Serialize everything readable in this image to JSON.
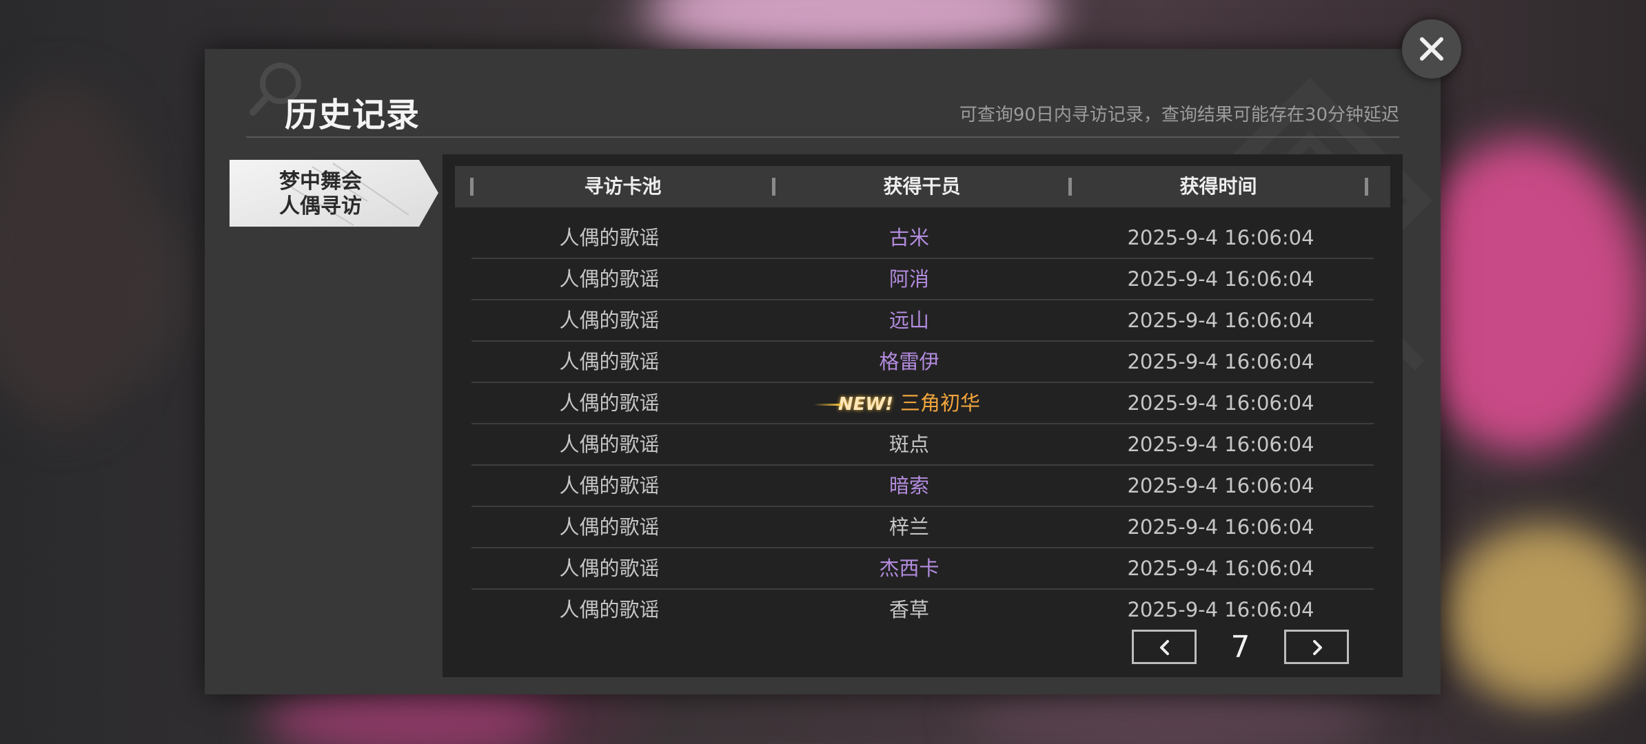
{
  "dialog": {
    "title": "历史记录",
    "notice": "可查询90日内寻访记录，查询结果可能存在30分钟延迟"
  },
  "pool_tab": {
    "label": "梦中舞会\n人偶寻访"
  },
  "table": {
    "headers": [
      "寻访卡池",
      "获得干员",
      "获得时间"
    ],
    "rows": [
      {
        "pool": "人偶的歌谣",
        "operator": "古米",
        "rarity_color": "purple",
        "new": false,
        "time": "2025-9-4 16:06:04"
      },
      {
        "pool": "人偶的歌谣",
        "operator": "阿消",
        "rarity_color": "purple",
        "new": false,
        "time": "2025-9-4 16:06:04"
      },
      {
        "pool": "人偶的歌谣",
        "operator": "远山",
        "rarity_color": "purple",
        "new": false,
        "time": "2025-9-4 16:06:04"
      },
      {
        "pool": "人偶的歌谣",
        "operator": "格雷伊",
        "rarity_color": "purple",
        "new": false,
        "time": "2025-9-4 16:06:04"
      },
      {
        "pool": "人偶的歌谣",
        "operator": "三角初华",
        "rarity_color": "orange",
        "new": true,
        "new_label": "NEW!",
        "time": "2025-9-4 16:06:04"
      },
      {
        "pool": "人偶的歌谣",
        "operator": "斑点",
        "rarity_color": "gray",
        "new": false,
        "time": "2025-9-4 16:06:04"
      },
      {
        "pool": "人偶的歌谣",
        "operator": "暗索",
        "rarity_color": "purple",
        "new": false,
        "time": "2025-9-4 16:06:04"
      },
      {
        "pool": "人偶的歌谣",
        "operator": "梓兰",
        "rarity_color": "gray",
        "new": false,
        "time": "2025-9-4 16:06:04"
      },
      {
        "pool": "人偶的歌谣",
        "operator": "杰西卡",
        "rarity_color": "purple",
        "new": false,
        "time": "2025-9-4 16:06:04"
      },
      {
        "pool": "人偶的歌谣",
        "operator": "香草",
        "rarity_color": "gray",
        "new": false,
        "time": "2025-9-4 16:06:04"
      }
    ]
  },
  "pager": {
    "page": "7",
    "prev_icon": "chevron-left-icon",
    "next_icon": "chevron-right-icon"
  },
  "colors": {
    "purple": "#b48cdf",
    "orange": "#f1a53b",
    "gray": "#c6c6c6"
  },
  "close_icon": "close-icon"
}
